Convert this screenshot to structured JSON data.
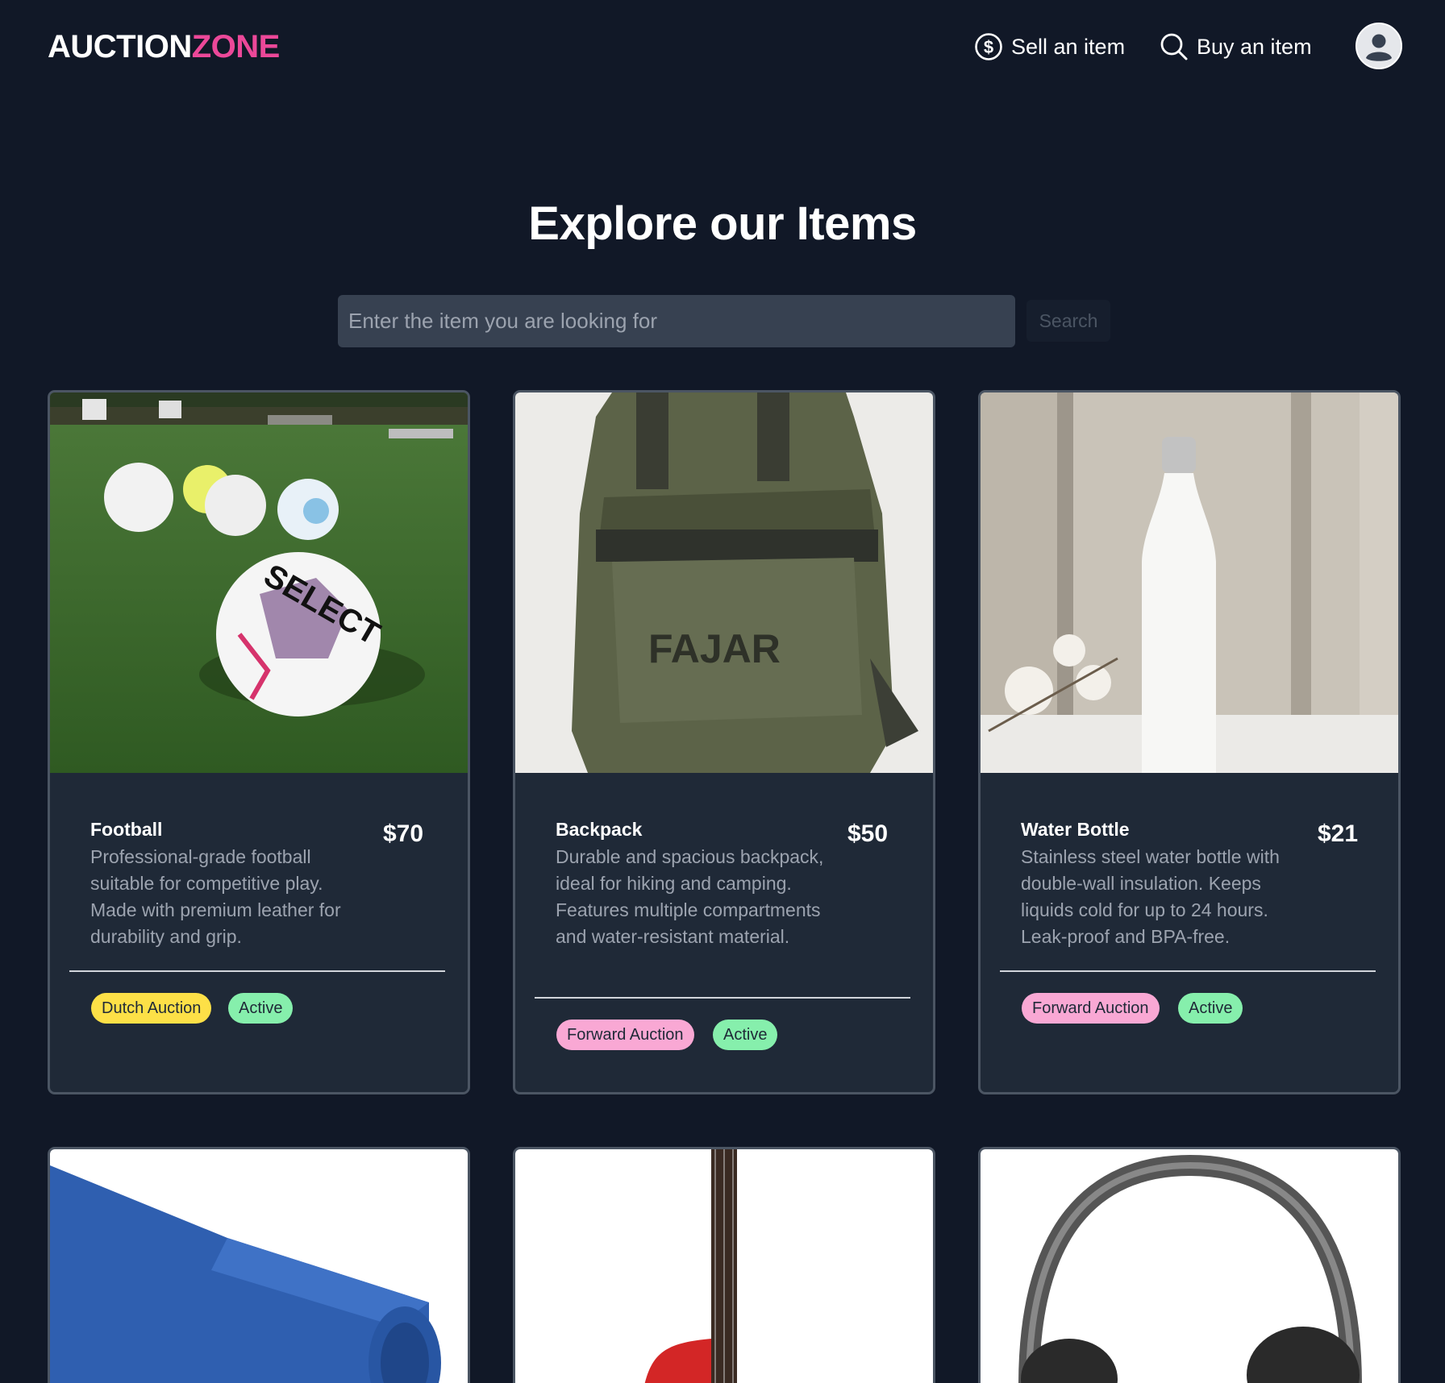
{
  "brand": {
    "part1": "AUCTION",
    "part2": "ZONE"
  },
  "nav": {
    "sell_label": "Sell an item",
    "buy_label": "Buy an item"
  },
  "hero": {
    "title": "Explore our Items"
  },
  "search": {
    "placeholder": "Enter the item you are looking for",
    "value": "",
    "button_label": "Search"
  },
  "items": [
    {
      "title": "Football",
      "price": "$70",
      "description": "Professional-grade football suitable for competitive play. Made with premium leather for durability and grip.",
      "auction_type": "Dutch Auction",
      "status": "Active"
    },
    {
      "title": "Backpack",
      "price": "$50",
      "description": "Durable and spacious backpack, ideal for hiking and camping. Features multiple compartments and water-resistant material.",
      "auction_type": "Forward Auction",
      "status": "Active"
    },
    {
      "title": "Water Bottle",
      "price": "$21",
      "description": "Stainless steel water bottle with double-wall insulation. Keeps liquids cold for up to 24 hours. Leak-proof and BPA-free.",
      "auction_type": "Forward Auction",
      "status": "Active"
    }
  ],
  "colors": {
    "background": "#111827",
    "card": "#1f2937",
    "brand_accent": "#ec4899",
    "dutch_badge": "#fde047",
    "forward_badge": "#f9a8d4",
    "active_badge": "#86efac"
  }
}
